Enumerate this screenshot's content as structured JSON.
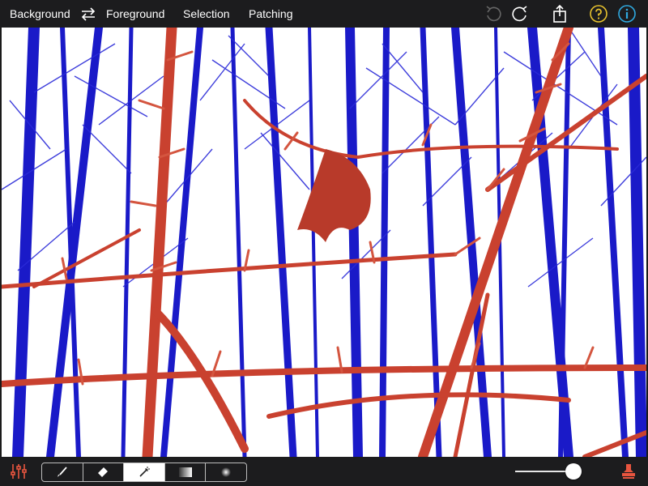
{
  "toolbar": {
    "tabs": [
      {
        "id": "background",
        "label": "Background"
      },
      {
        "id": "foreground",
        "label": "Foreground"
      },
      {
        "id": "selection",
        "label": "Selection"
      },
      {
        "id": "patching",
        "label": "Patching"
      }
    ],
    "icons": {
      "swap": "swap-arrows-icon",
      "undo": "undo-icon",
      "redo": "redo-icon",
      "share": "share-icon",
      "help": "help-icon",
      "info": "info-icon"
    }
  },
  "tools": [
    {
      "id": "brush",
      "icon": "brush-icon",
      "active": false
    },
    {
      "id": "eraser",
      "icon": "eraser-icon",
      "active": false
    },
    {
      "id": "magic-wand",
      "icon": "magic-wand-icon",
      "active": true
    },
    {
      "id": "gradient",
      "icon": "gradient-icon",
      "active": false
    },
    {
      "id": "radial",
      "icon": "radial-gradient-icon",
      "active": false
    }
  ],
  "brush_size": {
    "value": 0.9
  },
  "colors": {
    "toolbar_bg": "#1c1c1e",
    "help_yellow": "#e6c12e",
    "info_blue": "#2fa9e0",
    "mask_red": "#c9412f",
    "trees_blue": "#1a1ac8",
    "undo_disabled": "#666666"
  }
}
